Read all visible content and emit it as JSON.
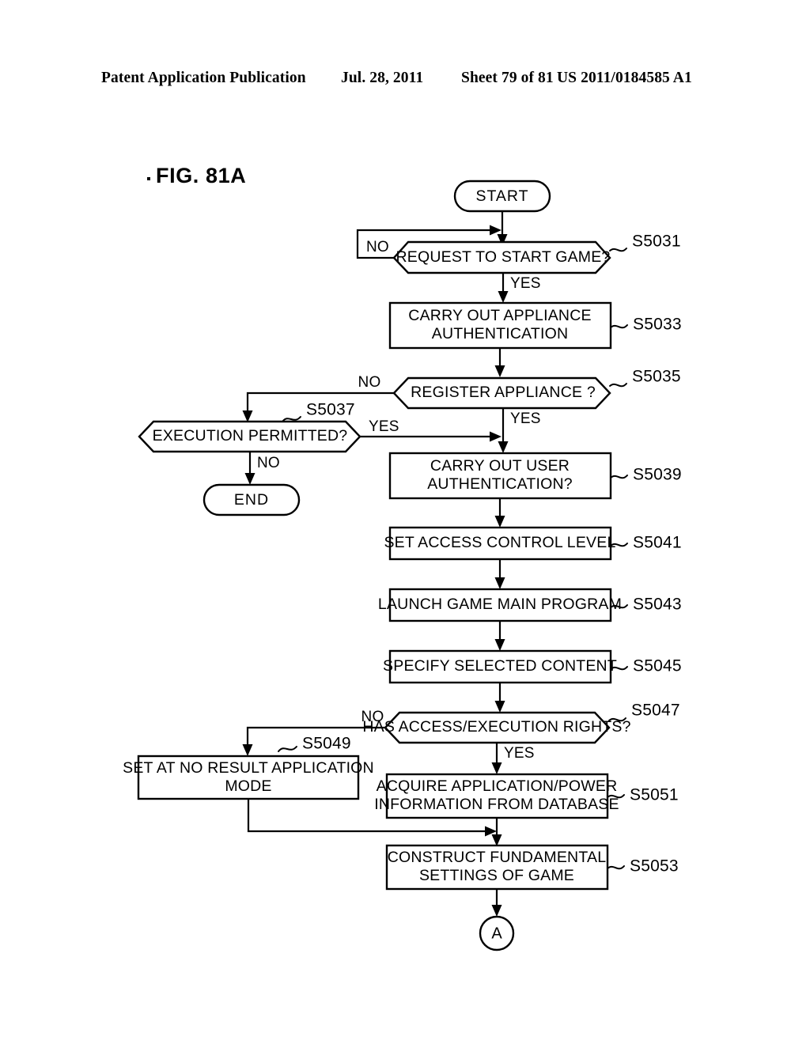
{
  "header": {
    "publication": "Patent Application Publication",
    "date": "Jul. 28, 2011",
    "sheet": "Sheet 79 of 81",
    "number": "US 2011/0184585 A1"
  },
  "figure": {
    "title": "FIG. 81A"
  },
  "chart_data": {
    "type": "diagram",
    "title": "FIG. 81A",
    "nodes": [
      {
        "id": "start",
        "kind": "terminator",
        "label": "START",
        "step": ""
      },
      {
        "id": "s5031",
        "kind": "decision",
        "label": "REQUEST TO START GAME?",
        "step": "S5031"
      },
      {
        "id": "s5033",
        "kind": "process",
        "label_line1": "CARRY OUT APPLIANCE",
        "label_line2": "AUTHENTICATION",
        "step": "S5033"
      },
      {
        "id": "s5035",
        "kind": "decision",
        "label": "REGISTER APPLIANCE ?",
        "step": "S5035"
      },
      {
        "id": "s5037",
        "kind": "decision",
        "label": "EXECUTION PERMITTED?",
        "step": "S5037"
      },
      {
        "id": "end",
        "kind": "terminator",
        "label": "END",
        "step": ""
      },
      {
        "id": "s5039",
        "kind": "process",
        "label_line1": "CARRY OUT USER",
        "label_line2": "AUTHENTICATION?",
        "step": "S5039"
      },
      {
        "id": "s5041",
        "kind": "process",
        "label_line1": "SET ACCESS CONTROL LEVEL",
        "label_line2": "",
        "step": "S5041"
      },
      {
        "id": "s5043",
        "kind": "process",
        "label_line1": "LAUNCH GAME MAIN PROGRAM",
        "label_line2": "",
        "step": "S5043"
      },
      {
        "id": "s5045",
        "kind": "process",
        "label_line1": "SPECIFY SELECTED CONTENT",
        "label_line2": "",
        "step": "S5045"
      },
      {
        "id": "s5047",
        "kind": "decision",
        "label": "HAS ACCESS/EXECUTION RIGHTS?",
        "step": "S5047"
      },
      {
        "id": "s5049",
        "kind": "process",
        "label_line1": "SET AT NO RESULT APPLICATION",
        "label_line2": "MODE",
        "step": "S5049"
      },
      {
        "id": "s5051",
        "kind": "process",
        "label_line1": "ACQUIRE APPLICATION/POWER",
        "label_line2": "INFORMATION FROM DATABASE",
        "step": "S5051"
      },
      {
        "id": "s5053",
        "kind": "process",
        "label_line1": "CONSTRUCT FUNDAMENTAL",
        "label_line2": "SETTINGS OF GAME",
        "step": "S5053"
      },
      {
        "id": "connA",
        "kind": "connector",
        "label": "A",
        "step": ""
      }
    ],
    "edges": [
      {
        "from": "start",
        "to": "s5031",
        "label": ""
      },
      {
        "from": "s5031",
        "to": "s5031",
        "label": "NO"
      },
      {
        "from": "s5031",
        "to": "s5033",
        "label": "YES"
      },
      {
        "from": "s5033",
        "to": "s5035",
        "label": ""
      },
      {
        "from": "s5035",
        "to": "s5037",
        "label": "NO"
      },
      {
        "from": "s5035",
        "to": "s5039",
        "label": "YES"
      },
      {
        "from": "s5037",
        "to": "s5039",
        "label": "YES"
      },
      {
        "from": "s5037",
        "to": "end",
        "label": "NO"
      },
      {
        "from": "s5039",
        "to": "s5041",
        "label": ""
      },
      {
        "from": "s5041",
        "to": "s5043",
        "label": ""
      },
      {
        "from": "s5043",
        "to": "s5045",
        "label": ""
      },
      {
        "from": "s5045",
        "to": "s5047",
        "label": ""
      },
      {
        "from": "s5047",
        "to": "s5049",
        "label": "NO"
      },
      {
        "from": "s5047",
        "to": "s5051",
        "label": "YES"
      },
      {
        "from": "s5049",
        "to": "s5053",
        "label": ""
      },
      {
        "from": "s5051",
        "to": "s5053",
        "label": ""
      },
      {
        "from": "s5053",
        "to": "connA",
        "label": ""
      }
    ]
  },
  "flow": {
    "start": {
      "label": "START"
    },
    "end": {
      "label": "END"
    },
    "connector_a": {
      "label": "A"
    },
    "s5031": {
      "text": "REQUEST TO START GAME?",
      "step": "S5031",
      "no": "NO",
      "yes": "YES"
    },
    "s5033": {
      "line1": "CARRY OUT APPLIANCE",
      "line2": "AUTHENTICATION",
      "step": "S5033"
    },
    "s5035": {
      "text": "REGISTER APPLIANCE ?",
      "step": "S5035",
      "no": "NO",
      "yes": "YES"
    },
    "s5037": {
      "text": "EXECUTION PERMITTED?",
      "step": "S5037",
      "no": "NO",
      "yes": "YES"
    },
    "s5039": {
      "line1": "CARRY OUT USER",
      "line2": "AUTHENTICATION?",
      "step": "S5039"
    },
    "s5041": {
      "line1": "SET ACCESS CONTROL LEVEL",
      "step": "S5041"
    },
    "s5043": {
      "line1": "LAUNCH GAME MAIN PROGRAM",
      "step": "S5043"
    },
    "s5045": {
      "line1": "SPECIFY SELECTED CONTENT",
      "step": "S5045"
    },
    "s5047": {
      "text": "HAS ACCESS/EXECUTION RIGHTS?",
      "step": "S5047",
      "no": "NO",
      "yes": "YES"
    },
    "s5049": {
      "line1": "SET AT NO RESULT APPLICATION",
      "line2": "MODE",
      "step": "S5049"
    },
    "s5051": {
      "line1": "ACQUIRE APPLICATION/POWER",
      "line2": "INFORMATION FROM DATABASE",
      "step": "S5051"
    },
    "s5053": {
      "line1": "CONSTRUCT FUNDAMENTAL",
      "line2": "SETTINGS OF GAME",
      "step": "S5053"
    }
  }
}
